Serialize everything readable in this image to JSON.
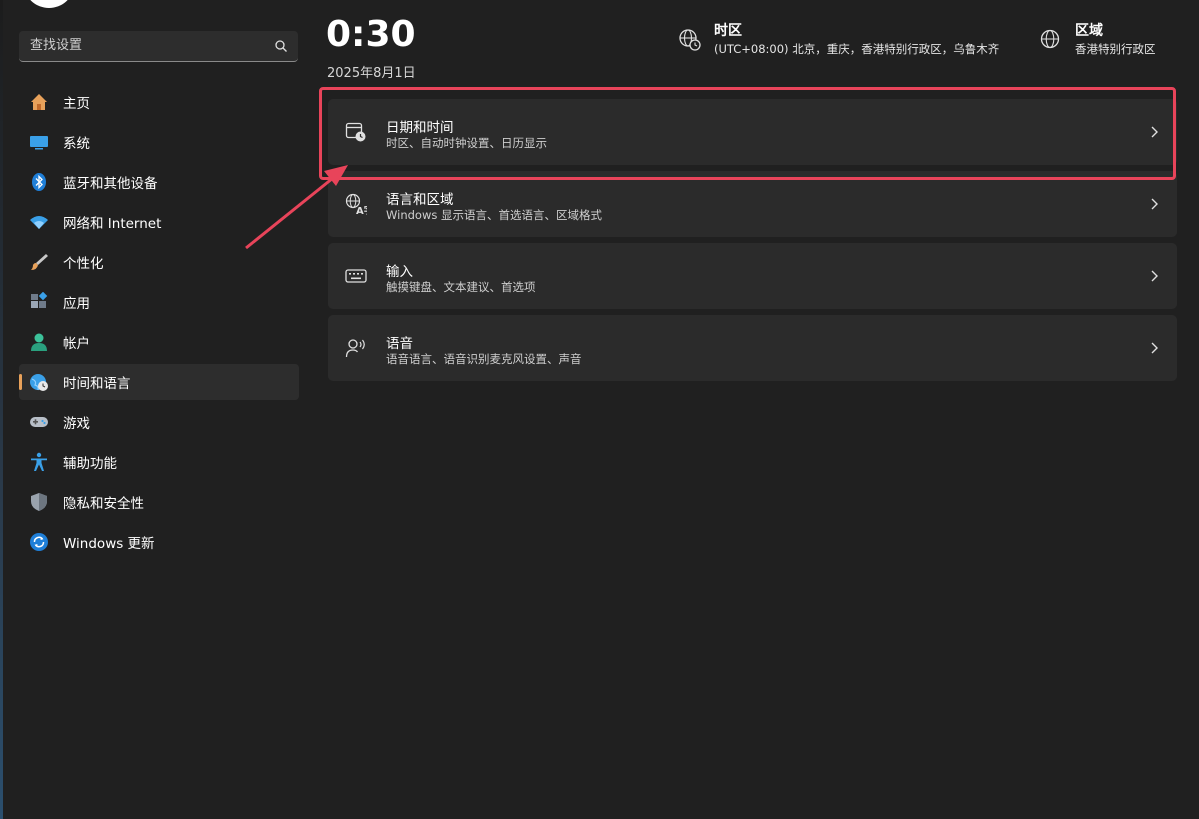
{
  "search": {
    "placeholder": "查找设置"
  },
  "sidebar": {
    "items": [
      {
        "label": "主页",
        "icon": "home-icon"
      },
      {
        "label": "系统",
        "icon": "monitor-icon"
      },
      {
        "label": "蓝牙和其他设备",
        "icon": "bluetooth-icon"
      },
      {
        "label": "网络和 Internet",
        "icon": "wifi-icon"
      },
      {
        "label": "个性化",
        "icon": "brush-icon"
      },
      {
        "label": "应用",
        "icon": "apps-icon"
      },
      {
        "label": "帐户",
        "icon": "person-icon"
      },
      {
        "label": "时间和语言",
        "icon": "globe-clock-icon",
        "active": true
      },
      {
        "label": "游戏",
        "icon": "gamepad-icon"
      },
      {
        "label": "辅助功能",
        "icon": "accessibility-icon"
      },
      {
        "label": "隐私和安全性",
        "icon": "shield-icon"
      },
      {
        "label": "Windows 更新",
        "icon": "update-icon"
      }
    ]
  },
  "header": {
    "time": "0:30",
    "date": "2025年8月1日",
    "timezone": {
      "title": "时区",
      "value": "(UTC+08:00) 北京，重庆，香港特别行政区，乌鲁木齐"
    },
    "region": {
      "title": "区域",
      "value": "香港特别行政区"
    }
  },
  "cards": [
    {
      "title": "日期和时间",
      "subtitle": "时区、自动时钟设置、日历显示",
      "icon": "calendar-clock-icon"
    },
    {
      "title": "语言和区域",
      "subtitle": "Windows 显示语言、首选语言、区域格式",
      "icon": "language-icon"
    },
    {
      "title": "输入",
      "subtitle": "触摸键盘、文本建议、首选项",
      "icon": "keyboard-icon"
    },
    {
      "title": "语音",
      "subtitle": "语音语言、语音识别麦克风设置、声音",
      "icon": "speech-icon"
    }
  ],
  "colors": {
    "accent": "#e8a15a",
    "highlight": "#e8445a",
    "background": "#202020",
    "card": "#2b2b2b"
  }
}
